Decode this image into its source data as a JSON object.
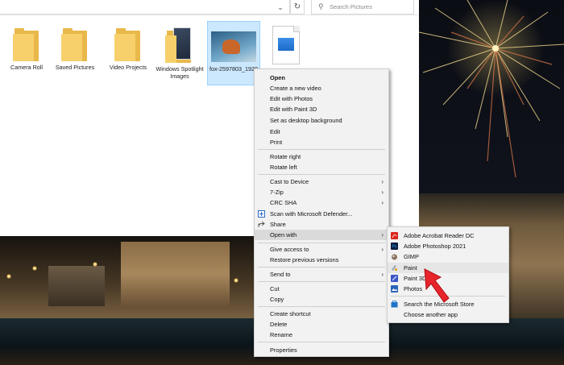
{
  "explorer": {
    "search_placeholder": "Search Pictures",
    "refresh_icon": "refresh-icon",
    "files": [
      {
        "name": "Camera Roll",
        "type": "folder"
      },
      {
        "name": "Saved Pictures",
        "type": "folder"
      },
      {
        "name": "Video Projects",
        "type": "folder"
      },
      {
        "name": "Windows Spotlight Images",
        "type": "folder-photo"
      },
      {
        "name": "fox-2597803_1920",
        "type": "image",
        "selected": true
      },
      {
        "name": "",
        "type": "image-file"
      }
    ]
  },
  "context_menu": {
    "items": [
      {
        "label": "Open",
        "bold": true
      },
      {
        "label": "Create a new video"
      },
      {
        "label": "Edit with Photos"
      },
      {
        "label": "Edit with Paint 3D"
      },
      {
        "label": "Set as desktop background"
      },
      {
        "label": "Edit"
      },
      {
        "label": "Print"
      },
      {
        "label": "Rotate right"
      },
      {
        "label": "Rotate left"
      },
      {
        "label": "Cast to Device",
        "submenu": true
      },
      {
        "label": "7-Zip",
        "submenu": true
      },
      {
        "label": "CRC SHA",
        "submenu": true
      },
      {
        "label": "Scan with Microsoft Defender..."
      },
      {
        "label": "Share"
      },
      {
        "label": "Open with",
        "submenu": true,
        "highlighted": true
      },
      {
        "label": "Give access to",
        "submenu": true
      },
      {
        "label": "Restore previous versions"
      },
      {
        "label": "Send to",
        "submenu": true
      },
      {
        "label": "Cut"
      },
      {
        "label": "Copy"
      },
      {
        "label": "Create shortcut"
      },
      {
        "label": "Delete"
      },
      {
        "label": "Rename"
      },
      {
        "label": "Properties"
      }
    ]
  },
  "open_with_menu": {
    "apps": [
      {
        "label": "Adobe Acrobat Reader DC",
        "icon": "acrobat-icon",
        "color": "#d9261c"
      },
      {
        "label": "Adobe Photoshop 2021",
        "icon": "photoshop-icon",
        "color": "#0a1b3d"
      },
      {
        "label": "GIMP",
        "icon": "gimp-icon",
        "color": "#6b5a48"
      },
      {
        "label": "Paint",
        "icon": "paint-icon",
        "color": "#9aa8b8",
        "hovered": true
      },
      {
        "label": "Paint 3D",
        "icon": "paint3d-icon",
        "color": "#3a56c8"
      },
      {
        "label": "Photos",
        "icon": "photos-icon",
        "color": "#2a62b8"
      }
    ],
    "store": "Search the Microsoft Store",
    "choose": "Choose another app"
  },
  "colors": {
    "accent_arrow": "#e8242b",
    "selection": "#cce8ff"
  }
}
